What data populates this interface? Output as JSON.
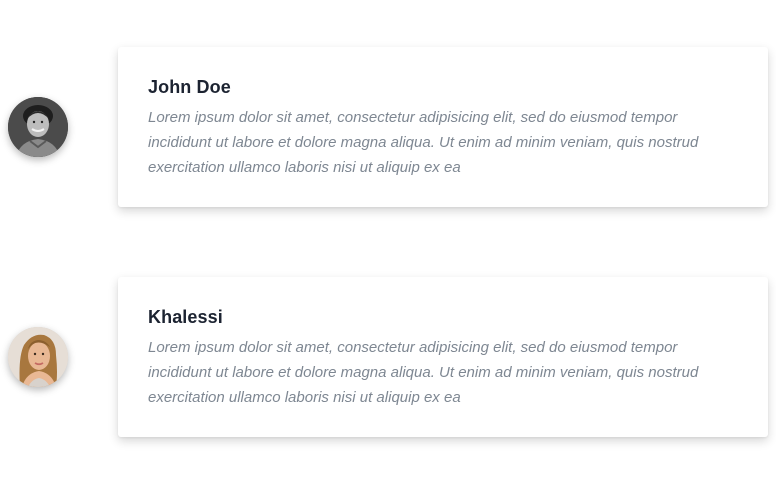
{
  "testimonials": [
    {
      "name": "John Doe",
      "text": "Lorem ipsum dolor sit amet, consectetur adipisicing elit, sed do eiusmod tempor incididunt ut labore et dolore magna aliqua. Ut enim ad minim veniam, quis nostrud exercitation ullamco laboris nisi ut aliquip ex ea",
      "avatar": "avatar-man-icon"
    },
    {
      "name": "Khalessi",
      "text": "Lorem ipsum dolor sit amet, consectetur adipisicing elit, sed do eiusmod tempor incididunt ut labore et dolore magna aliqua. Ut enim ad minim veniam, quis nostrud exercitation ullamco laboris nisi ut aliquip ex ea",
      "avatar": "avatar-woman-icon"
    }
  ],
  "colors": {
    "name_text": "#1c2331",
    "body_text": "#7e8792",
    "card_background": "#ffffff"
  }
}
